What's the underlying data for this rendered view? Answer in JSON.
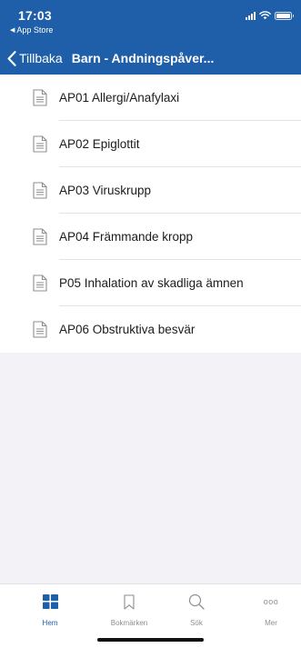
{
  "status_bar": {
    "time": "17:03",
    "back_app": "App Store"
  },
  "nav": {
    "back_label": "Tillbaka",
    "title": "Barn - Andningspåver..."
  },
  "colors": {
    "header_bg": "#1f5ea8",
    "active_tab": "#1f5ea8",
    "inactive_tab": "#8e8e93"
  },
  "list": {
    "items": [
      {
        "label": "AP01 Allergi/Anafylaxi",
        "icon": "document-icon"
      },
      {
        "label": "AP02 Epiglottit",
        "icon": "document-icon"
      },
      {
        "label": "AP03 Viruskrupp",
        "icon": "document-icon"
      },
      {
        "label": "AP04 Främmande kropp",
        "icon": "document-icon"
      },
      {
        "label": "P05 Inhalation av skadliga ämnen",
        "icon": "document-icon"
      },
      {
        "label": "AP06 Obstruktiva besvär",
        "icon": "document-icon"
      }
    ]
  },
  "tabbar": {
    "active": "Hem",
    "tabs": [
      {
        "label": "Hem",
        "icon": "grid-icon"
      },
      {
        "label": "Bokmärken",
        "icon": "bookmark-icon"
      },
      {
        "label": "Sök",
        "icon": "search-icon"
      },
      {
        "label": "Mer",
        "icon": "more-icon"
      }
    ]
  }
}
